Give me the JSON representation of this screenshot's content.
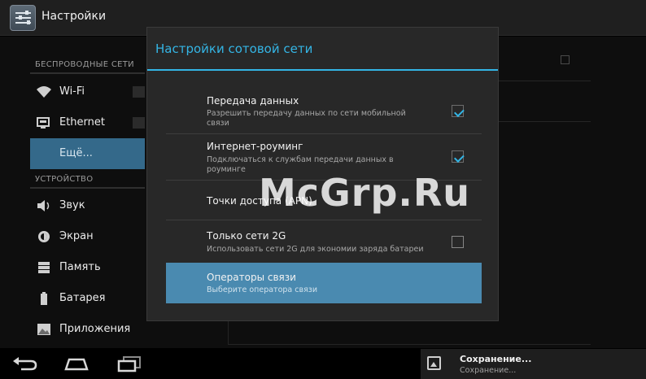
{
  "action_bar": {
    "title": "Настройки",
    "icon": "settings-icon"
  },
  "nav": {
    "wireless_header": "БЕСПРОВОДНЫЕ СЕТИ",
    "device_header": "УСТРОЙСТВО",
    "items": [
      {
        "label": "Wi-Fi",
        "icon": "wifi-icon"
      },
      {
        "label": "Ethernet",
        "icon": "ethernet-icon"
      },
      {
        "label": "Ещё...",
        "icon": ""
      },
      {
        "label": "Звук",
        "icon": "speaker-icon"
      },
      {
        "label": "Экран",
        "icon": "brightness-icon"
      },
      {
        "label": "Память",
        "icon": "storage-icon"
      },
      {
        "label": "Батарея",
        "icon": "battery-icon"
      },
      {
        "label": "Приложения",
        "icon": "apps-icon"
      }
    ]
  },
  "dialog": {
    "title": "Настройки сотовой сети",
    "rows": [
      {
        "title": "Передача данных",
        "subtitle": "Разрешить передачу данных по сети мобильной связи",
        "checked": true
      },
      {
        "title": "Интернет-роуминг",
        "subtitle": "Подключаться к службам передачи данных в роуминге",
        "checked": true
      },
      {
        "title": "Точки доступа (APN)",
        "subtitle": ""
      },
      {
        "title": "Только сети 2G",
        "subtitle": "Использовать сети 2G для экономии заряда батареи",
        "checked": false
      },
      {
        "title": "Операторы связи",
        "subtitle": "Выберите оператора связи"
      }
    ]
  },
  "watermark": "McGrp.Ru",
  "notification": {
    "title": "Сохранение...",
    "subtitle": "Сохранение..."
  },
  "colors": {
    "accent": "#33b5e5",
    "selected": "#34698a",
    "highlight": "#4a8ab0"
  }
}
